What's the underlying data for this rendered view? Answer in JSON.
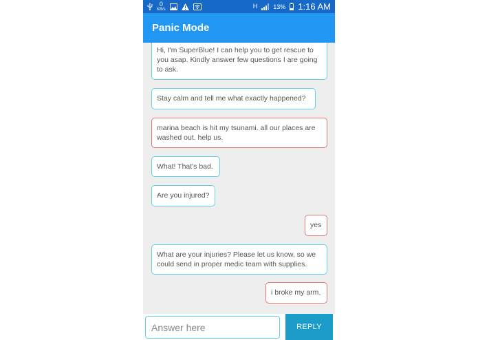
{
  "status_bar": {
    "left_icons": [
      "usb-icon",
      "data-speed-icon",
      "image-icon",
      "warning-icon",
      "wifi-icon"
    ],
    "data_speed_value": "0",
    "data_speed_unit": "KB/s",
    "network_type": "H",
    "battery_percent": "13%",
    "time": "1:16 AM"
  },
  "toolbar": {
    "title": "Panic Mode"
  },
  "messages": [
    {
      "sender": "bot",
      "text": "Hi, I'm SuperBlue! I can help you to get rescue to you asap. Kindly answer few questions I are going to ask."
    },
    {
      "sender": "bot",
      "text": "Stay calm and tell me what exactly happened?"
    },
    {
      "sender": "user",
      "text": "marina beach is hit my tsunami. all our places are washed out. help us."
    },
    {
      "sender": "bot",
      "text": "What! That's bad."
    },
    {
      "sender": "bot",
      "text": "Are you injured?"
    },
    {
      "sender": "user",
      "text": "yes"
    },
    {
      "sender": "bot",
      "text": "What are your injuries? Please let us know, so we could send in proper medic team with supplies."
    },
    {
      "sender": "user",
      "text": "i broke my arm."
    }
  ],
  "input": {
    "placeholder": "Answer here",
    "value": ""
  },
  "reply_button": {
    "label": "REPLY"
  },
  "colors": {
    "status_bar": "#1769c7",
    "toolbar": "#2196f3",
    "bot_border": "#5fd3e8",
    "user_border": "#e07878",
    "reply_button": "#1a9bc8"
  }
}
